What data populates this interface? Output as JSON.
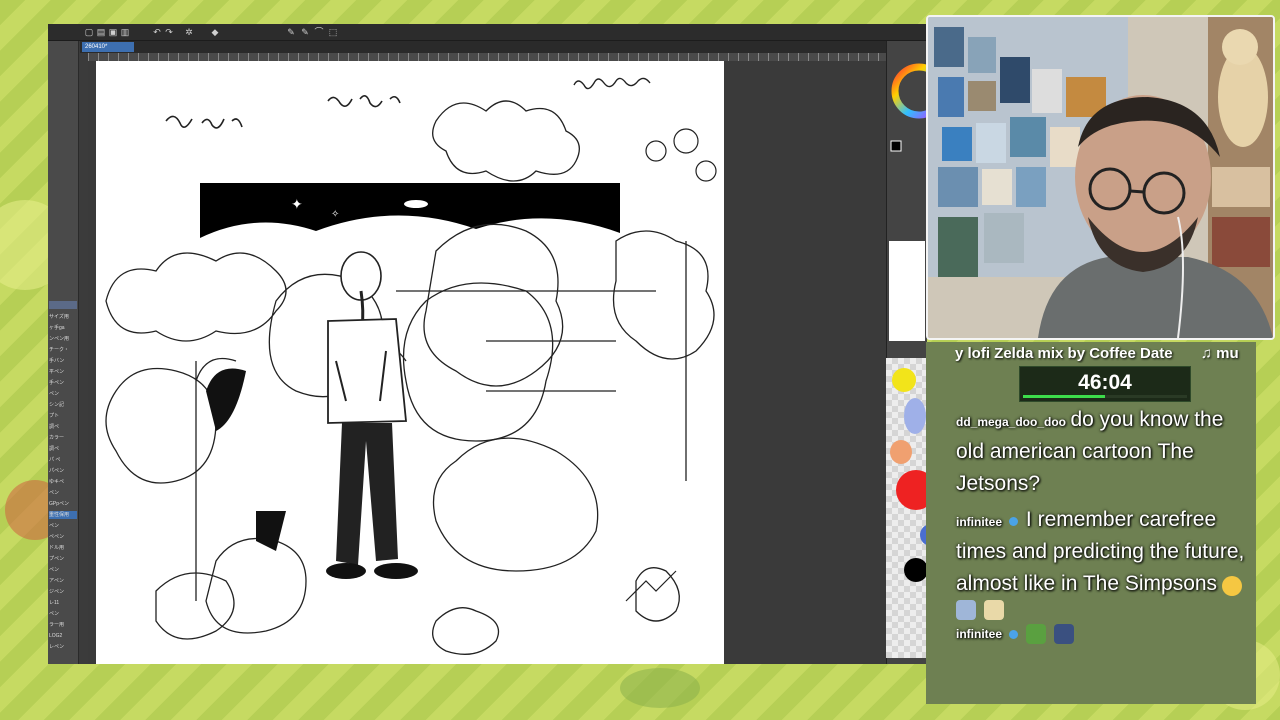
{
  "app": {
    "tab_label": "260410*",
    "left_panel_items": [
      "サイズ用",
      "ヶ手ga",
      "ンペン用",
      "チーク・",
      "手バン",
      "平ペン",
      "手ペン",
      "ペン",
      "シン記",
      "プト",
      "調ペ",
      "カラー",
      "調ペ",
      "パ ペ",
      "パペン",
      "ゆキペ",
      "ペン",
      "GPpペン",
      "重性保用",
      "ペン",
      "ペペン",
      "ドル用",
      "プペン",
      "ペン",
      "アペン",
      "ジペン",
      "レ11",
      "ペン",
      "ラー用",
      "LOG2",
      "レペン"
    ]
  },
  "overlay": {
    "now_playing": "y lofi Zelda mix by Coffee Date",
    "now_playing_icon": "♫ mu",
    "timer": "46:04",
    "timer_progress": 0.5
  },
  "chat": [
    {
      "user": "dd_mega_doo_doo",
      "text": "do you know the old american cartoon The Jetsons?"
    },
    {
      "user": "infinitee",
      "text": "I remember carefree times and predicting the future, almost like in The Simpsons"
    },
    {
      "user": "infinitee",
      "text": ""
    }
  ],
  "colors": {
    "accent": "#3d6fb0",
    "timer_green": "#3ddc4b",
    "overlay_green": "#6e8052",
    "background_green": "#b6cf55"
  },
  "icons": [
    "undo-icon",
    "redo-icon",
    "save-icon",
    "new-icon",
    "color-wheel-icon",
    "music-note-icon",
    "verified-badge-icon"
  ]
}
